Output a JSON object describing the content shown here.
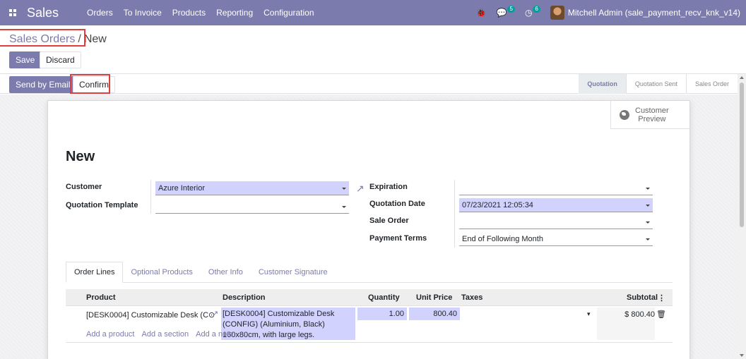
{
  "navbar": {
    "app_name": "Sales",
    "menu": [
      "Orders",
      "To Invoice",
      "Products",
      "Reporting",
      "Configuration"
    ],
    "chat_count": "5",
    "activity_count": "6",
    "user": "Mitchell Admin (sale_payment_recv_knk_v14)"
  },
  "breadcrumb": {
    "parent": "Sales Orders",
    "separator": "/",
    "current": "New"
  },
  "buttons": {
    "save": "Save",
    "discard": "Discard",
    "send_email": "Send by Email",
    "confirm": "Confirm"
  },
  "stages": [
    "Quotation",
    "Quotation Sent",
    "Sales Order"
  ],
  "preview": {
    "line1": "Customer",
    "line2": "Preview"
  },
  "form": {
    "title": "New",
    "customer_label": "Customer",
    "customer_value": "Azure Interior",
    "template_label": "Quotation Template",
    "template_value": "",
    "expiration_label": "Expiration",
    "expiration_value": "",
    "quotation_date_label": "Quotation Date",
    "quotation_date_value": "07/23/2021 12:05:34",
    "sale_order_label": "Sale Order",
    "sale_order_value": "",
    "payment_terms_label": "Payment Terms",
    "payment_terms_value": "End of Following Month"
  },
  "tabs": [
    "Order Lines",
    "Optional Products",
    "Other Info",
    "Customer Signature"
  ],
  "table": {
    "headers": {
      "product": "Product",
      "description": "Description",
      "quantity": "Quantity",
      "unit_price": "Unit Price",
      "taxes": "Taxes",
      "subtotal": "Subtotal"
    },
    "row": {
      "product": "[DESK0004] Customizable Desk (C⊙",
      "description_1": "[DESK0004] Customizable Desk",
      "description_2": "(CONFIG) (Aluminium, Black)",
      "description_3": "160x80cm, with large legs.",
      "quantity": "1.00",
      "unit_price": "800.40",
      "subtotal": "$ 800.40"
    },
    "add_product": "Add a product",
    "add_section": "Add a section",
    "add_note": "Add a note"
  }
}
